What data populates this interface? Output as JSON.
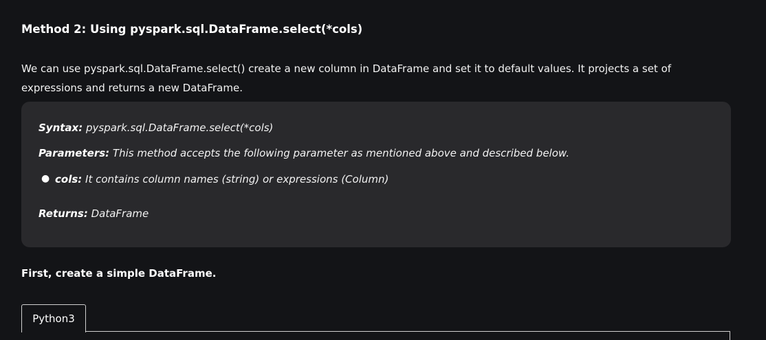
{
  "heading": "Method 2: Using pyspark.sql.DataFrame.select(*cols)",
  "intro": "We can use pyspark.sql.DataFrame.select() create a new column in DataFrame and set it to default values. It projects a set of expressions and returns a new DataFrame.",
  "syntax_box": {
    "syntax_label": "Syntax:",
    "syntax_value": " pyspark.sql.DataFrame.select(*cols)",
    "parameters_label": "Parameters:",
    "parameters_value": " This method accepts the following parameter as mentioned above and described below.",
    "bullet_label": "cols:",
    "bullet_value": " It contains column names (string) or expressions (Column)",
    "returns_label": "Returns:",
    "returns_value": " DataFrame"
  },
  "first_line": "First, create a simple DataFrame.",
  "code_tab": {
    "label": "Python3"
  }
}
